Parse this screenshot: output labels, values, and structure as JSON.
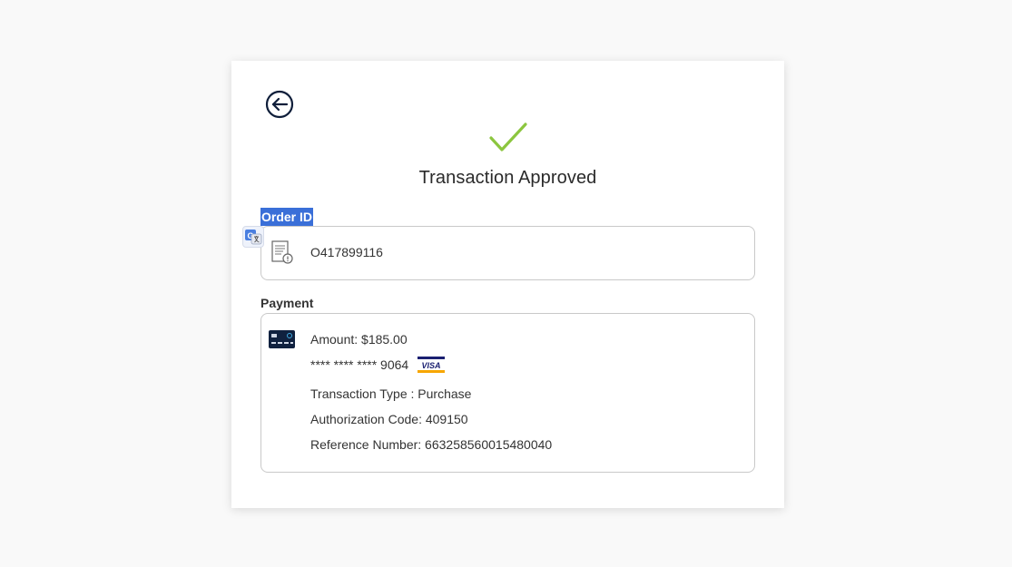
{
  "page": {
    "title": "Transaction Approved",
    "back_icon": "back-arrow-circle-icon",
    "status_icon": "checkmark-icon",
    "accent_color": "#8cc63f"
  },
  "order": {
    "label": "Order ID",
    "value": "O417899116",
    "icon": "document-icon"
  },
  "payment": {
    "label": "Payment",
    "icon": "credit-card-icon",
    "amount": "Amount: $185.00",
    "card_number": "**** **** **** 9064",
    "card_brand": "VISA",
    "transaction_type": "Transaction Type : Purchase",
    "authorization_code": "Authorization Code: 409150",
    "reference_number": "Reference Number: 663258560015480040"
  },
  "overlay": {
    "translate_icon": "google-translate-icon"
  }
}
